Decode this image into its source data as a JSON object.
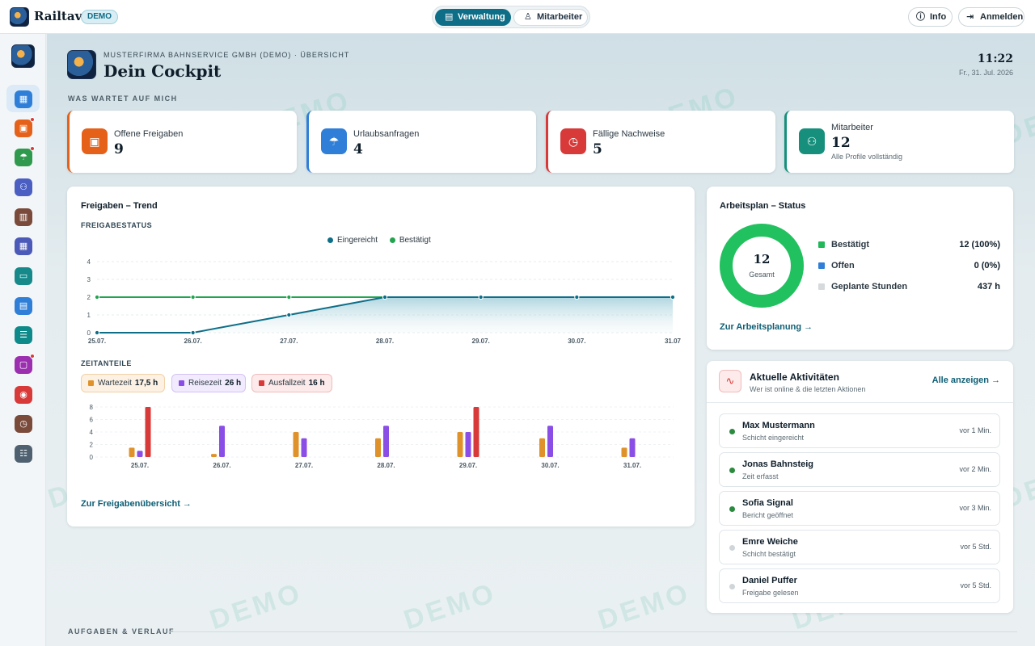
{
  "app": {
    "name": "Railtavo",
    "badge": "DEMO"
  },
  "topbar": {
    "segments": [
      {
        "label": "Verwaltung",
        "icon": "building-icon",
        "active": true
      },
      {
        "label": "Mitarbeiter",
        "icon": "user-icon",
        "active": false
      }
    ],
    "info_label": "Info",
    "login_label": "Anmelden"
  },
  "sidebar": {
    "items": [
      {
        "name": "dashboard",
        "color": "#2f7fd8",
        "active": true
      },
      {
        "name": "approvals",
        "color": "#e5611a",
        "badge": true
      },
      {
        "name": "vacation",
        "color": "#2f9a4e",
        "badge": true
      },
      {
        "name": "employees",
        "color": "#4a5fc1"
      },
      {
        "name": "reports",
        "color": "#7a4a3a"
      },
      {
        "name": "calendar",
        "color": "#4b59b8"
      },
      {
        "name": "folders",
        "color": "#168a8a"
      },
      {
        "name": "documents",
        "color": "#2f7fd8"
      },
      {
        "name": "checklist",
        "color": "#0f8a8a"
      },
      {
        "name": "messages",
        "color": "#9b2fb0",
        "badge": true
      },
      {
        "name": "signal",
        "color": "#d83a3a"
      },
      {
        "name": "history",
        "color": "#7a4a3a"
      },
      {
        "name": "settings",
        "color": "#4f6170"
      }
    ]
  },
  "header": {
    "subtitle": "MUSTERFIRMA BAHNSERVICE GMBH (DEMO) · ÜBERSICHT",
    "title": "Dein Cockpit",
    "time": "11:22",
    "date": "Fr., 31. Jul. 2026"
  },
  "watermark": "DEMO",
  "section_waiting": "WAS WARTET AUF MICH",
  "section_tasks": "AUFGABEN & VERLAUF",
  "kpis": [
    {
      "label": "Offene Freigaben",
      "value": "9",
      "color": "#e5611a",
      "icon": "clipboard-icon"
    },
    {
      "label": "Urlaubsanfragen",
      "value": "4",
      "color": "#2f7fd8",
      "icon": "umbrella-icon"
    },
    {
      "label": "Fällige Nachweise",
      "value": "5",
      "color": "#d83a3a",
      "icon": "calendar-clock-icon"
    },
    {
      "label": "Mitarbeiter",
      "value": "12",
      "note": "Alle Profile vollständig",
      "color": "#16907c",
      "icon": "users-icon"
    }
  ],
  "trend": {
    "title": "Freigaben – Trend",
    "status_label": "FREIGABESTATUS",
    "time_label": "ZEITANTEILE",
    "link": "Zur Freigabenübersicht"
  },
  "chart_data": [
    {
      "type": "line",
      "x": [
        "25.07.",
        "26.07.",
        "27.07.",
        "28.07.",
        "29.07.",
        "30.07.",
        "31.07"
      ],
      "ylim": [
        0,
        4
      ],
      "yticks": [
        0,
        1,
        2,
        3,
        4
      ],
      "legend": "top-center",
      "series": [
        {
          "name": "Eingereicht",
          "color": "#0e6e87",
          "values": [
            0,
            0,
            1,
            2,
            2,
            2,
            2
          ]
        },
        {
          "name": "Bestätigt",
          "color": "#22a44f",
          "values": [
            2,
            2,
            2,
            2,
            2,
            2,
            2
          ]
        }
      ]
    },
    {
      "type": "bar",
      "categories": [
        "25.07.",
        "26.07.",
        "27.07.",
        "28.07.",
        "29.07.",
        "30.07.",
        "31.07."
      ],
      "ylim": [
        0,
        8
      ],
      "yticks": [
        0,
        2,
        4,
        6,
        8
      ],
      "series": [
        {
          "name": "Wartezeit",
          "total": "17,5 h",
          "color": "#e0922a",
          "values": [
            1.5,
            0.5,
            4,
            3,
            4,
            3,
            1.5
          ]
        },
        {
          "name": "Reisezeit",
          "total": "26 h",
          "color": "#8a4ee6",
          "values": [
            1,
            5,
            3,
            5,
            4,
            5,
            3
          ]
        },
        {
          "name": "Ausfallzeit",
          "total": "16 h",
          "color": "#d83a3a",
          "values": [
            8,
            0,
            0,
            0,
            8,
            0,
            0
          ]
        }
      ]
    }
  ],
  "workplan": {
    "title": "Arbeitsplan – Status",
    "total": "12",
    "total_label": "Gesamt",
    "confirmed_fraction": 1.0,
    "rows": [
      {
        "label": "Bestätigt",
        "value": "12 (100%)",
        "color": "#22b85a"
      },
      {
        "label": "Offen",
        "value": "0 (0%)",
        "color": "#2f7fd8"
      },
      {
        "label": "Geplante Stunden",
        "value": "437 h",
        "color": "#d6dadd"
      }
    ],
    "link": "Zur Arbeitsplanung"
  },
  "activity": {
    "title": "Aktuelle Aktivitäten",
    "subtitle": "Wer ist online & die letzten Aktionen",
    "link": "Alle anzeigen",
    "items": [
      {
        "name": "Max Mustermann",
        "desc": "Schicht eingereicht",
        "time": "vor 1 Min.",
        "online": true
      },
      {
        "name": "Jonas Bahnsteig",
        "desc": "Zeit erfasst",
        "time": "vor 2 Min.",
        "online": true
      },
      {
        "name": "Sofia Signal",
        "desc": "Bericht geöffnet",
        "time": "vor 3 Min.",
        "online": true
      },
      {
        "name": "Emre Weiche",
        "desc": "Schicht bestätigt",
        "time": "vor 5 Std.",
        "online": false
      },
      {
        "name": "Daniel Puffer",
        "desc": "Freigabe gelesen",
        "time": "vor 5 Std.",
        "online": false
      }
    ]
  }
}
